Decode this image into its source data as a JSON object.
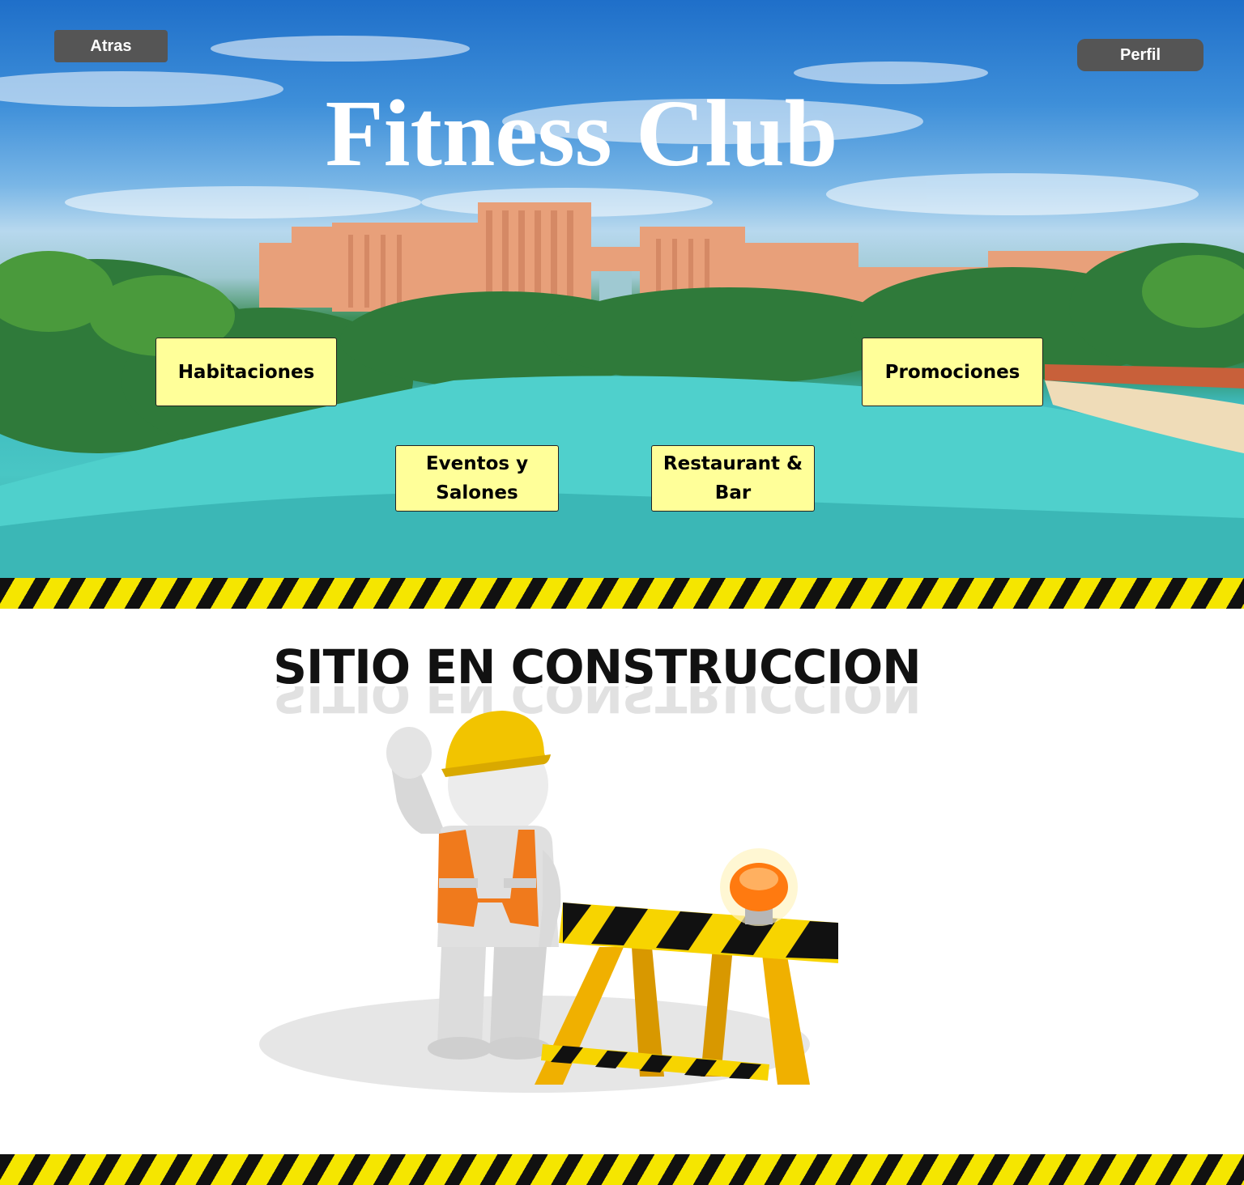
{
  "header": {
    "back_label": "Atras",
    "profile_label": "Perfil",
    "title": "Fitness Club"
  },
  "nav": {
    "habitaciones": "Habitaciones",
    "promociones": "Promociones",
    "eventos_line1": "Eventos y",
    "eventos_line2": "Salones",
    "restaurant_line1": "Restaurant &",
    "restaurant_line2": "Bar"
  },
  "construction": {
    "title": "SITIO EN CONSTRUCCION"
  },
  "colors": {
    "nav_button_bg": "#ffff99",
    "dark_button_bg": "#555555",
    "hazard_yellow": "#f5e600",
    "hazard_black": "#111111"
  },
  "icons": {
    "worker": "construction-worker-icon",
    "barrier": "road-barrier-icon",
    "warning_light": "warning-light-icon"
  }
}
